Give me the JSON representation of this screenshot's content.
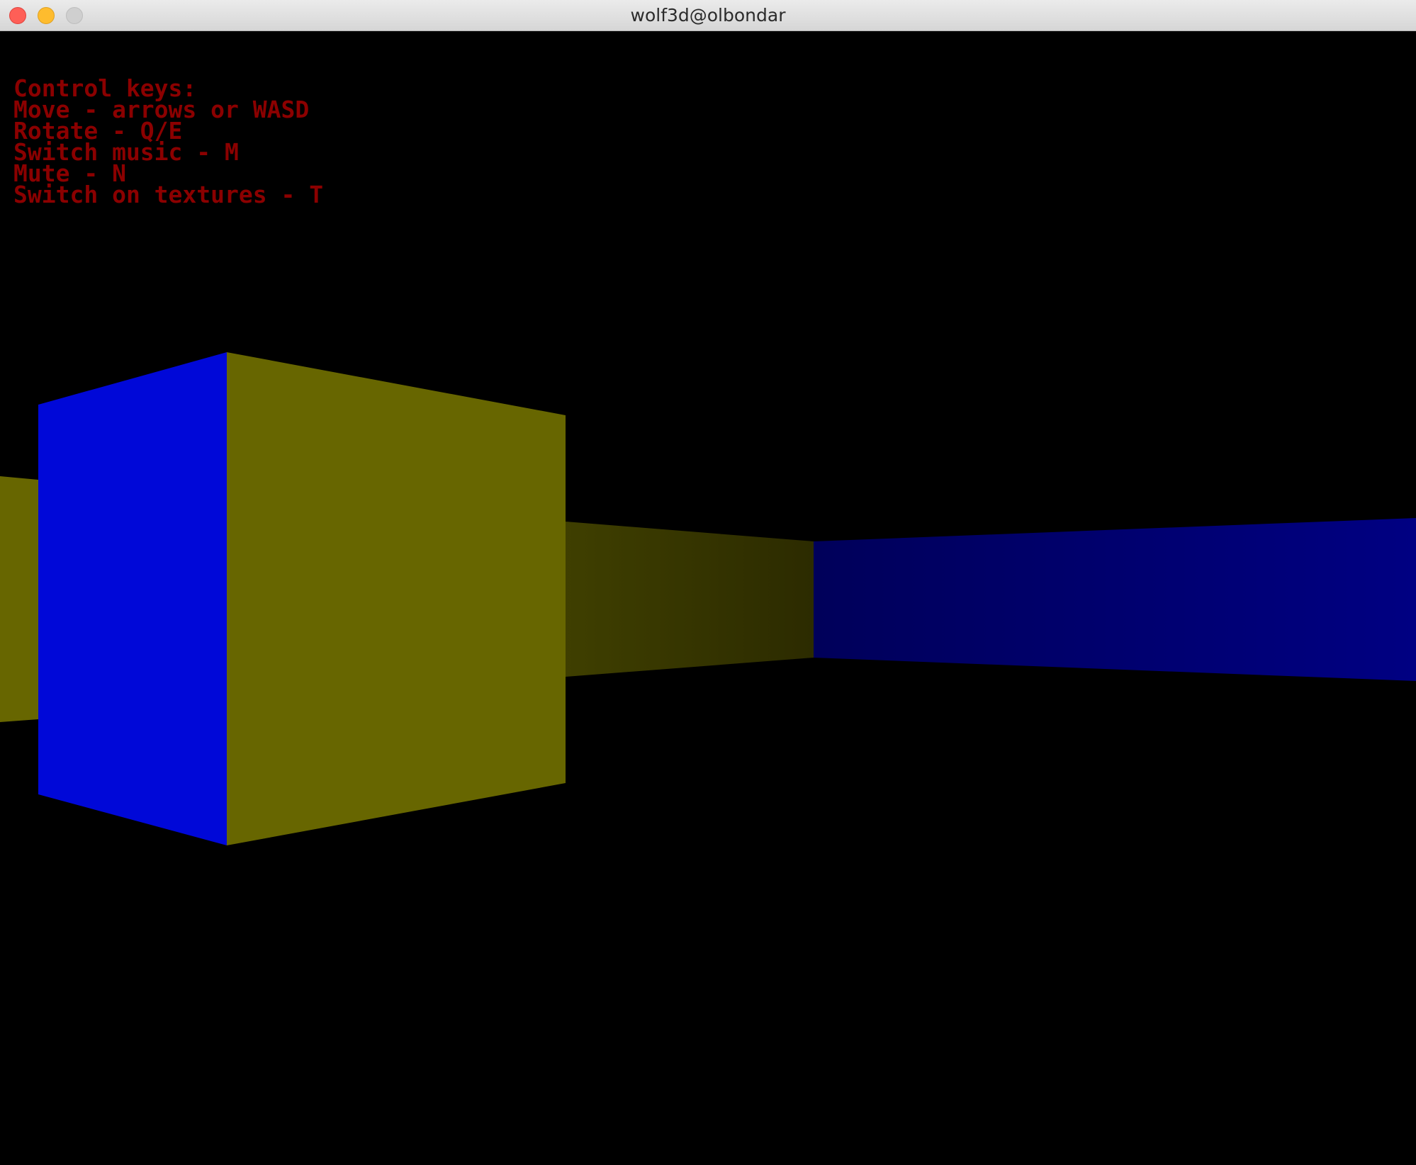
{
  "window": {
    "title": "wolf3d@olbondar"
  },
  "hud": {
    "color": "#8b0000",
    "lines": [
      "Control keys:",
      "Move - arrows or WASD",
      "Rotate - Q/E",
      "Switch music - M",
      "Mute - N",
      "Switch on textures - T"
    ]
  },
  "scene": {
    "background": "#000000",
    "wall_colors": {
      "olive": "#676600",
      "blue": "#0008d8",
      "olive_dark": "#3c3c00",
      "olive_darker": "#2f2e00",
      "navy": "#00005a",
      "navy_light": "#000080"
    }
  }
}
